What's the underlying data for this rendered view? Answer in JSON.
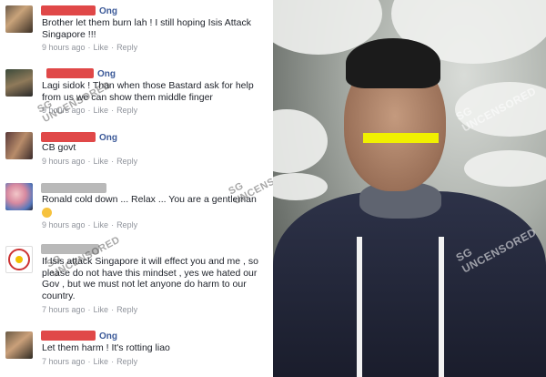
{
  "comments": [
    {
      "name_tail": "Ong",
      "text": "Brother let them burn lah ! I still hoping Isis Attack Singapore !!!",
      "time": "9 hours ago",
      "like": "Like",
      "reply": "Reply"
    },
    {
      "name_tail": "Ong",
      "text": "Lagi sidok ! Than when those Bastard ask for help from us we can show them middle finger",
      "time": "9 hours ago",
      "like": "Like",
      "reply": "Reply"
    },
    {
      "name_tail": "Ong",
      "text": "CB govt",
      "time": "9 hours ago",
      "like": "Like",
      "reply": "Reply"
    },
    {
      "name_tail": "",
      "text": "Ronald cold down ... Relax ... You are a gentleman",
      "time": "9 hours ago",
      "like": "Like",
      "reply": "Reply"
    },
    {
      "name_tail": "",
      "text": "If Isis attack Singapore it will effect you and me , so please do not have this mindset , yes we hated our Gov , but we must not let anyone do harm to our country.",
      "time": "7 hours ago",
      "like": "Like",
      "reply": "Reply"
    },
    {
      "name_tail": "Ong",
      "text": "Let them harm ! It's rotting liao",
      "time": "7 hours ago",
      "like": "Like",
      "reply": "Reply"
    }
  ],
  "watermark": {
    "top": "SG",
    "bottom": "UNCENSORED"
  },
  "colors": {
    "redaction": "#e04848",
    "eye_bar": "#f1f000",
    "meta": "#90949c"
  }
}
